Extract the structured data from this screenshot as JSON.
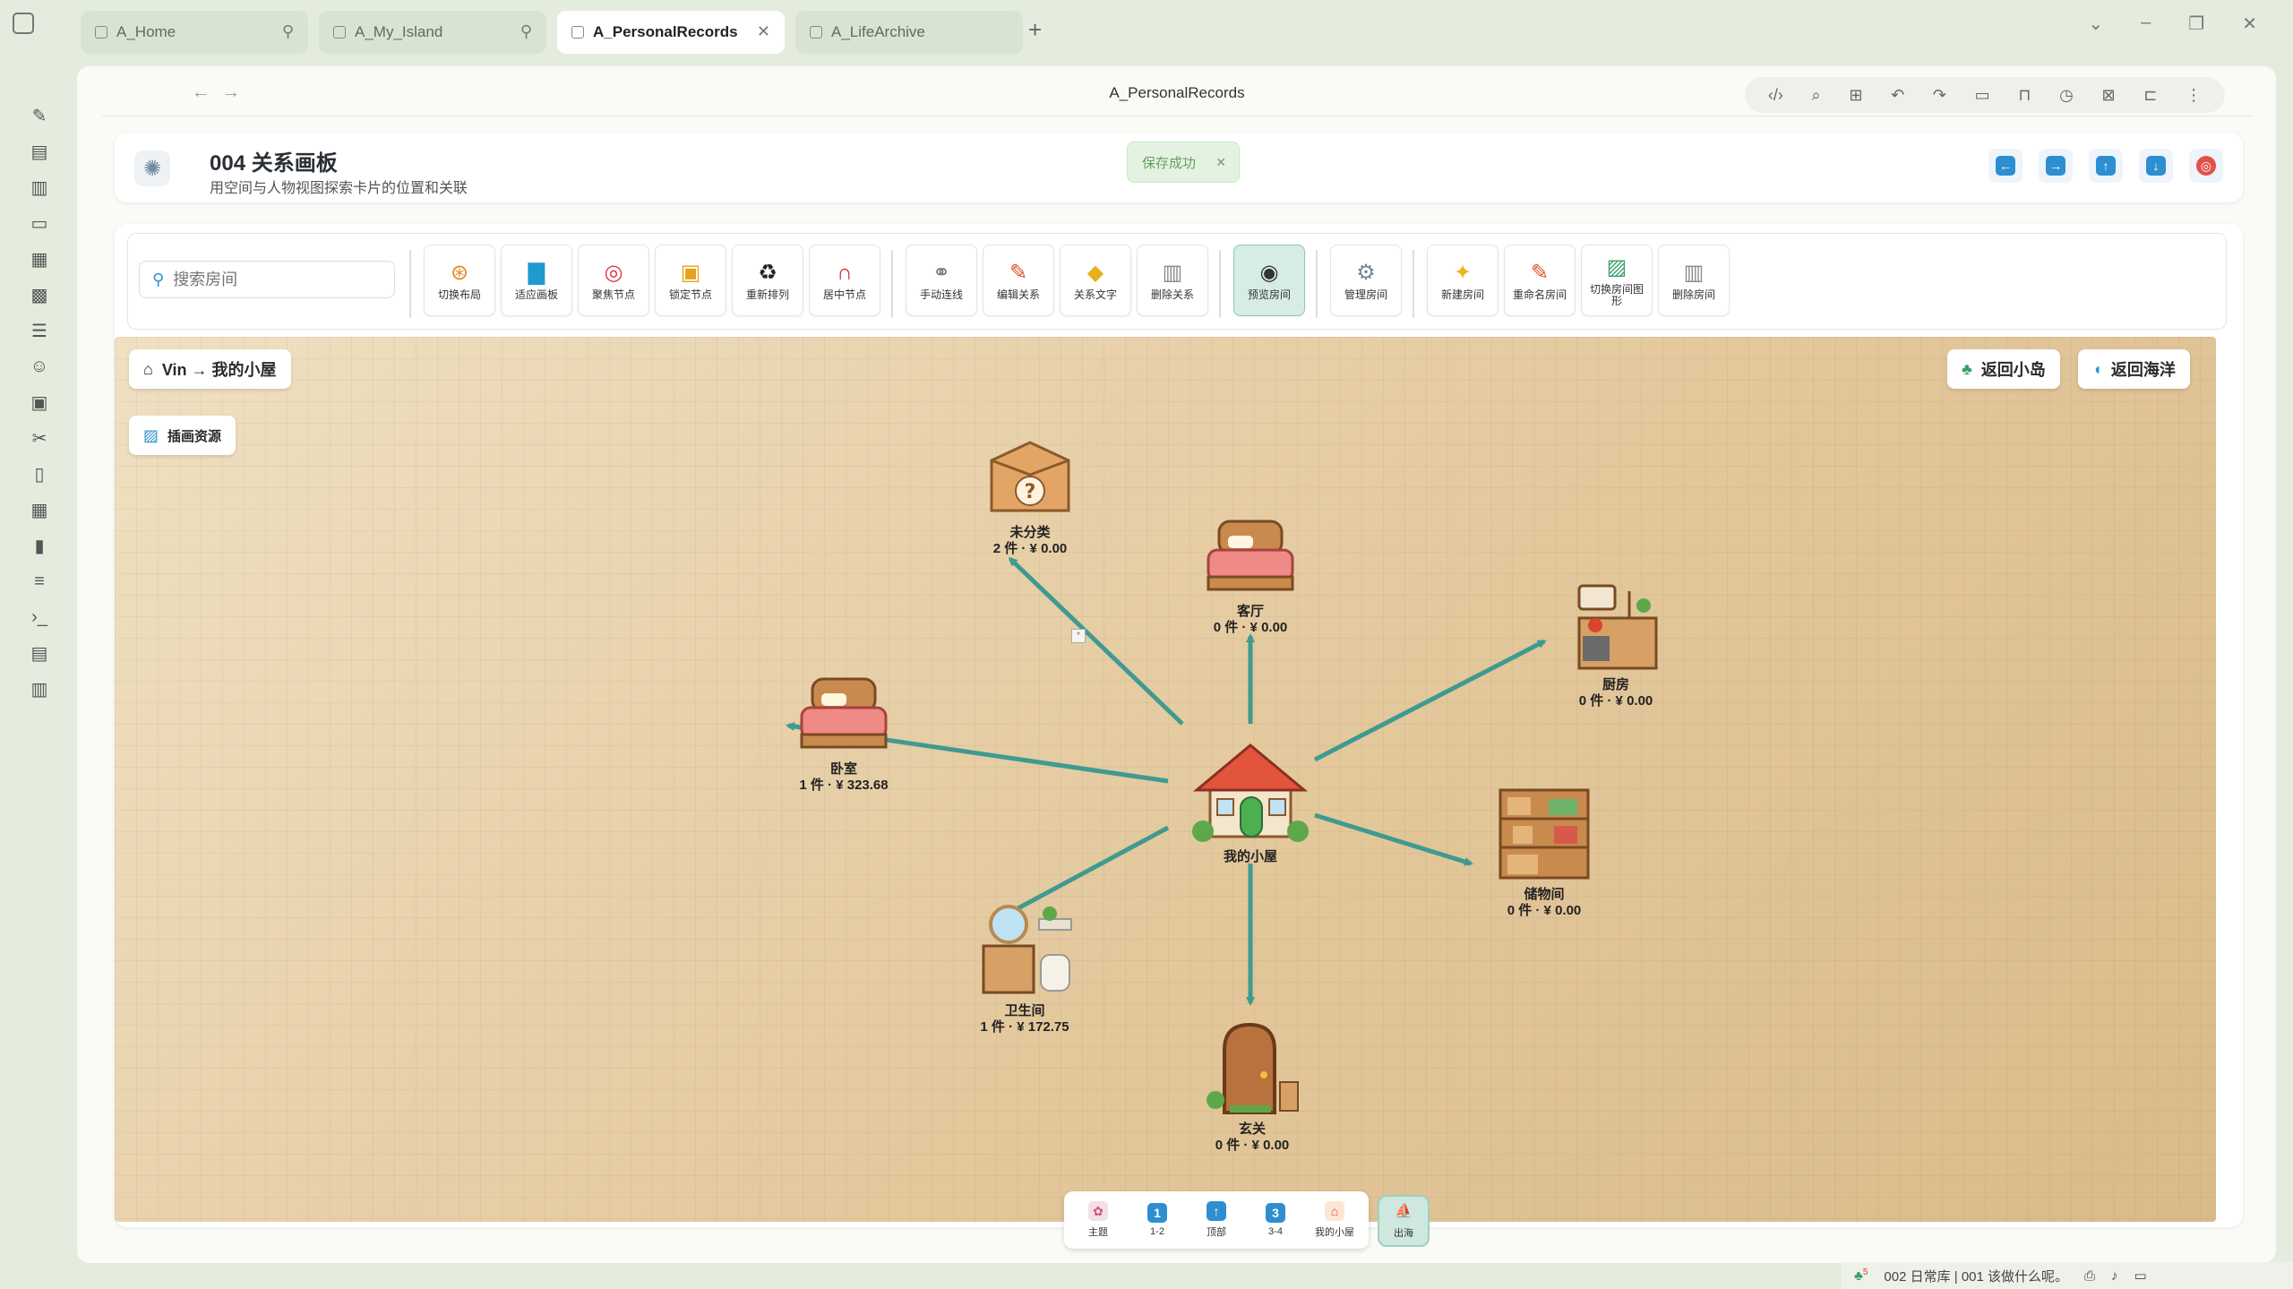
{
  "tabs": [
    {
      "label": "A_Home",
      "action": "pin",
      "active": false
    },
    {
      "label": "A_My_Island",
      "action": "pin",
      "active": false
    },
    {
      "label": "A_PersonalRecords",
      "action": "close",
      "active": true
    },
    {
      "label": "A_LifeArchive",
      "action": "",
      "active": false
    }
  ],
  "address": {
    "title": "A_PersonalRecords"
  },
  "header": {
    "title": "004 关系画板",
    "subtitle": "用空间与人物视图探索卡片的位置和关联",
    "toast": "保存成功"
  },
  "search": {
    "placeholder": "搜索房间"
  },
  "toolbar": {
    "buttons": [
      {
        "label": "切换布局",
        "icon": "compass-icon"
      },
      {
        "label": "适应画板",
        "icon": "map-icon"
      },
      {
        "label": "聚焦节点",
        "icon": "target-icon"
      },
      {
        "label": "锁定节点",
        "icon": "lock-icon"
      },
      {
        "label": "重新排列",
        "icon": "recycle-icon"
      },
      {
        "label": "居中节点",
        "icon": "magnet-icon"
      },
      {
        "label": "手动连线",
        "icon": "link-icon"
      },
      {
        "label": "编辑关系",
        "icon": "pencil-icon"
      },
      {
        "label": "关系文字",
        "icon": "tag-icon"
      },
      {
        "label": "删除关系",
        "icon": "trash-icon"
      },
      {
        "label": "预览房间",
        "icon": "eye-icon"
      },
      {
        "label": "管理房间",
        "icon": "gear-icon"
      },
      {
        "label": "新建房间",
        "icon": "sparkle-icon"
      },
      {
        "label": "重命名房间",
        "icon": "pencil-icon"
      },
      {
        "label": "切换房间图形",
        "icon": "picture-icon"
      },
      {
        "label": "删除房间",
        "icon": "trash-icon"
      }
    ]
  },
  "canvas": {
    "breadcrumb": "Vin → 我的小屋",
    "assets_label": "插画资源",
    "back_island": "返回小岛",
    "back_ocean": "返回海洋",
    "center": {
      "name": "我的小屋"
    },
    "rooms": [
      {
        "name": "未分类",
        "stat": "2 件 · ¥ 0.00"
      },
      {
        "name": "客厅",
        "stat": "0 件 · ¥ 0.00"
      },
      {
        "name": "厨房",
        "stat": "0 件 · ¥ 0.00"
      },
      {
        "name": "卧室",
        "stat": "1 件 · ¥ 323.68"
      },
      {
        "name": "储物间",
        "stat": "0 件 · ¥ 0.00"
      },
      {
        "name": "卫生间",
        "stat": "1 件 · ¥ 172.75"
      },
      {
        "name": "玄关",
        "stat": "0 件 · ¥ 0.00"
      }
    ]
  },
  "dock": {
    "buttons": [
      {
        "label": "主题",
        "glyph": ""
      },
      {
        "label": "1-2",
        "glyph": "1"
      },
      {
        "label": "顶部",
        "glyph": "↑"
      },
      {
        "label": "3-4",
        "glyph": "3"
      },
      {
        "label": "我的小屋",
        "glyph": ""
      }
    ],
    "sail": "出海"
  },
  "status": {
    "text": "002 日常库 | 001 该做什么呢。",
    "badge": "5"
  },
  "colors": {
    "edge": "#3f9a90",
    "accent": "#2e8fd0",
    "canvas": "#e6cfa6"
  }
}
